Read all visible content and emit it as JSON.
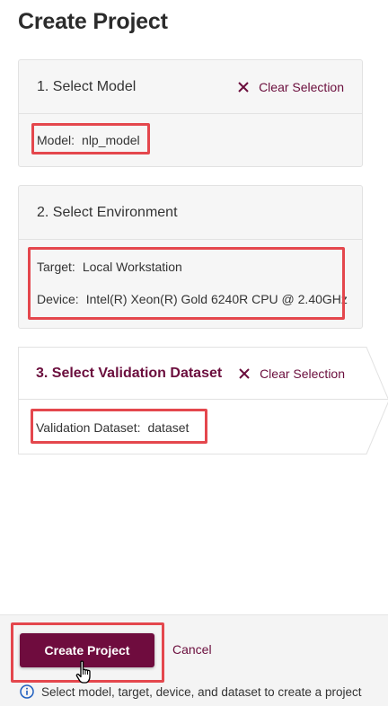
{
  "page": {
    "title": "Create Project"
  },
  "steps": [
    {
      "title": "1. Select Model",
      "clear_label": "Clear Selection",
      "fields": [
        {
          "label": "Model:",
          "value": "nlp_model"
        }
      ]
    },
    {
      "title": "2. Select Environment",
      "fields": [
        {
          "label": "Target:",
          "value": "Local Workstation"
        },
        {
          "label": "Device:",
          "value": "Intel(R) Xeon(R) Gold 6240R CPU @ 2.40GHz"
        }
      ]
    },
    {
      "title": "3. Select Validation Dataset",
      "clear_label": "Clear Selection",
      "fields": [
        {
          "label": "Validation Dataset:",
          "value": "dataset"
        }
      ]
    }
  ],
  "footer": {
    "primary_label": "Create Project",
    "cancel_label": "Cancel",
    "info_text": "Select model, target, device, and dataset to create a project"
  },
  "colors": {
    "accent": "#6b0e3d",
    "highlight": "#e4474d",
    "info_icon": "#1f5fbf"
  }
}
